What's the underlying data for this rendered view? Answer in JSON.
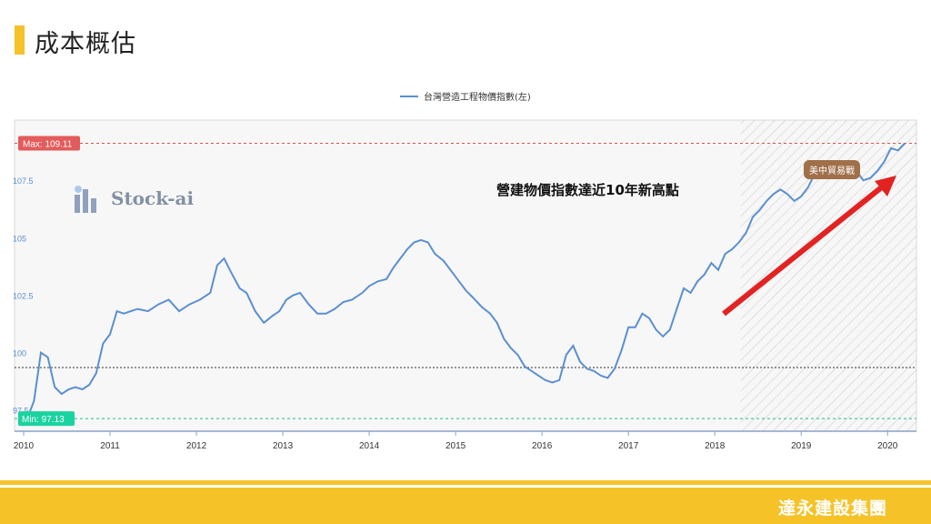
{
  "page": {
    "title": "成本概估",
    "company": "達永建設集團",
    "annotation": "營建物價指數達近10年新高點",
    "logo_text": "Stock-ai",
    "trade_war_label": "美中貿易戰",
    "accent_color": "#f5c228"
  },
  "chart_data": {
    "type": "line",
    "legend": "台灣營造工程物價指數(左)",
    "series_color": "#5b8fd0",
    "ylim": [
      96.5,
      110.2
    ],
    "yticks": [
      "107.5",
      "105",
      "102.5",
      "100",
      "97.5"
    ],
    "ytick_values": [
      107.5,
      105,
      102.5,
      100,
      97.5
    ],
    "xlim": [
      2010,
      2020.25
    ],
    "xticks": [
      "2010",
      "2011",
      "2012",
      "2013",
      "2014",
      "2015",
      "2016",
      "2017",
      "2018",
      "2019",
      "2020"
    ],
    "xtick_values": [
      2010,
      2011,
      2012,
      2013,
      2014,
      2015,
      2016,
      2017,
      2018,
      2019,
      2020
    ],
    "max_label": "Max: 109.11",
    "max_value": 109.11,
    "min_label": "Min: 97.13",
    "min_value": 97.13,
    "mean_value": 99.35,
    "shaded_from": 2018.3,
    "points": [
      [
        2010.04,
        97.1
      ],
      [
        2010.12,
        97.9
      ],
      [
        2010.2,
        100.0
      ],
      [
        2010.28,
        99.8
      ],
      [
        2010.36,
        98.5
      ],
      [
        2010.44,
        98.2
      ],
      [
        2010.52,
        98.4
      ],
      [
        2010.6,
        98.5
      ],
      [
        2010.68,
        98.4
      ],
      [
        2010.76,
        98.6
      ],
      [
        2010.84,
        99.1
      ],
      [
        2010.92,
        100.4
      ],
      [
        2011.0,
        100.8
      ],
      [
        2011.08,
        101.8
      ],
      [
        2011.16,
        101.7
      ],
      [
        2011.24,
        101.8
      ],
      [
        2011.32,
        101.9
      ],
      [
        2011.44,
        101.8
      ],
      [
        2011.56,
        102.1
      ],
      [
        2011.68,
        102.3
      ],
      [
        2011.8,
        101.8
      ],
      [
        2011.92,
        102.1
      ],
      [
        2012.04,
        102.3
      ],
      [
        2012.16,
        102.6
      ],
      [
        2012.24,
        103.8
      ],
      [
        2012.32,
        104.1
      ],
      [
        2012.4,
        103.5
      ],
      [
        2012.5,
        102.8
      ],
      [
        2012.58,
        102.6
      ],
      [
        2012.68,
        101.8
      ],
      [
        2012.78,
        101.3
      ],
      [
        2012.88,
        101.6
      ],
      [
        2012.96,
        101.8
      ],
      [
        2013.04,
        102.3
      ],
      [
        2013.12,
        102.5
      ],
      [
        2013.2,
        102.6
      ],
      [
        2013.3,
        102.1
      ],
      [
        2013.4,
        101.7
      ],
      [
        2013.5,
        101.7
      ],
      [
        2013.6,
        101.9
      ],
      [
        2013.7,
        102.2
      ],
      [
        2013.8,
        102.3
      ],
      [
        2013.92,
        102.6
      ],
      [
        2014.0,
        102.9
      ],
      [
        2014.1,
        103.1
      ],
      [
        2014.2,
        103.2
      ],
      [
        2014.28,
        103.7
      ],
      [
        2014.36,
        104.1
      ],
      [
        2014.44,
        104.5
      ],
      [
        2014.52,
        104.8
      ],
      [
        2014.6,
        104.9
      ],
      [
        2014.68,
        104.8
      ],
      [
        2014.76,
        104.3
      ],
      [
        2014.86,
        104.0
      ],
      [
        2014.96,
        103.5
      ],
      [
        2015.04,
        103.1
      ],
      [
        2015.12,
        102.7
      ],
      [
        2015.2,
        102.4
      ],
      [
        2015.3,
        102.0
      ],
      [
        2015.4,
        101.7
      ],
      [
        2015.48,
        101.3
      ],
      [
        2015.56,
        100.6
      ],
      [
        2015.64,
        100.2
      ],
      [
        2015.72,
        99.9
      ],
      [
        2015.8,
        99.4
      ],
      [
        2015.88,
        99.2
      ],
      [
        2015.96,
        99.0
      ],
      [
        2016.04,
        98.8
      ],
      [
        2016.12,
        98.7
      ],
      [
        2016.2,
        98.8
      ],
      [
        2016.28,
        99.9
      ],
      [
        2016.36,
        100.3
      ],
      [
        2016.44,
        99.6
      ],
      [
        2016.52,
        99.3
      ],
      [
        2016.6,
        99.2
      ],
      [
        2016.68,
        99.0
      ],
      [
        2016.76,
        98.9
      ],
      [
        2016.84,
        99.3
      ],
      [
        2016.92,
        100.1
      ],
      [
        2017.0,
        101.1
      ],
      [
        2017.08,
        101.1
      ],
      [
        2017.16,
        101.7
      ],
      [
        2017.24,
        101.5
      ],
      [
        2017.32,
        101.0
      ],
      [
        2017.4,
        100.7
      ],
      [
        2017.48,
        101.0
      ],
      [
        2017.56,
        101.9
      ],
      [
        2017.64,
        102.8
      ],
      [
        2017.72,
        102.6
      ],
      [
        2017.8,
        103.1
      ],
      [
        2017.88,
        103.4
      ],
      [
        2017.96,
        103.9
      ],
      [
        2018.04,
        103.6
      ],
      [
        2018.12,
        104.3
      ],
      [
        2018.2,
        104.5
      ],
      [
        2018.28,
        104.8
      ],
      [
        2018.36,
        105.2
      ],
      [
        2018.44,
        105.9
      ],
      [
        2018.52,
        106.2
      ],
      [
        2018.6,
        106.6
      ],
      [
        2018.68,
        106.9
      ],
      [
        2018.76,
        107.1
      ],
      [
        2018.84,
        106.9
      ],
      [
        2018.92,
        106.6
      ],
      [
        2019.0,
        106.8
      ],
      [
        2019.08,
        107.2
      ],
      [
        2019.16,
        107.8
      ],
      [
        2019.24,
        107.9
      ],
      [
        2019.32,
        107.7
      ],
      [
        2019.4,
        107.9
      ],
      [
        2019.48,
        107.9
      ],
      [
        2019.56,
        108.0
      ],
      [
        2019.64,
        107.9
      ],
      [
        2019.72,
        107.5
      ],
      [
        2019.8,
        107.6
      ],
      [
        2019.88,
        107.9
      ],
      [
        2019.96,
        108.3
      ],
      [
        2020.04,
        108.9
      ],
      [
        2020.12,
        108.8
      ],
      [
        2020.2,
        109.11
      ]
    ]
  }
}
